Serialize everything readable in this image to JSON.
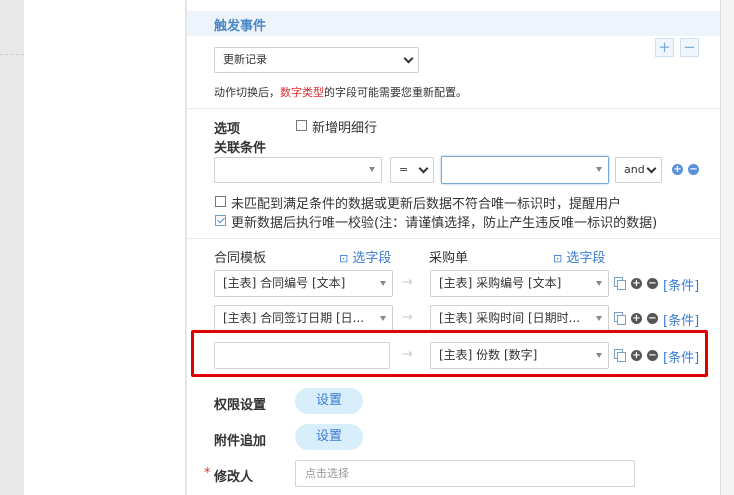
{
  "trigger": {
    "title": "触发事件",
    "event_select": "更新记录",
    "hint_prefix": "动作切换后，",
    "hint_highlight": "数字类型",
    "hint_suffix": "的字段可能需要您重新配置。",
    "add_symbol": "+",
    "remove_symbol": "−"
  },
  "options": {
    "label": "选项",
    "add_detail_row": "新增明细行",
    "assoc_label": "关联条件",
    "field_select": "",
    "op_select": "=",
    "value_select": "",
    "logic_select": "and",
    "check1": {
      "label": "未匹配到满足条件的数据或更新后数据不符合唯一标识时，提醒用户",
      "checked": false
    },
    "check2": {
      "label": "更新数据后执行唯一校验(注：请谨慎选择，防止产生违反唯一标识的数据)",
      "checked": true
    }
  },
  "mapping": {
    "left_title": "合同模板",
    "left_select_link": "选字段",
    "right_title": "采购单",
    "right_select_link": "选字段",
    "arrow": "→",
    "condition_label": "[条件]",
    "rows": [
      {
        "left": "[主表] 合同编号 [文本]",
        "right": "[主表] 采购编号 [文本]"
      },
      {
        "left": "[主表] 合同签订日期 [日...",
        "right": "[主表] 采购时间 [日期时..."
      },
      {
        "left": "",
        "right": "[主表] 份数 [数字]"
      }
    ]
  },
  "permissions": {
    "label": "权限设置",
    "button": "设置"
  },
  "attachment": {
    "label": "附件追加",
    "button": "设置"
  },
  "modifier": {
    "required_mark": "*",
    "label": "修改人",
    "placeholder": "点击选择"
  }
}
